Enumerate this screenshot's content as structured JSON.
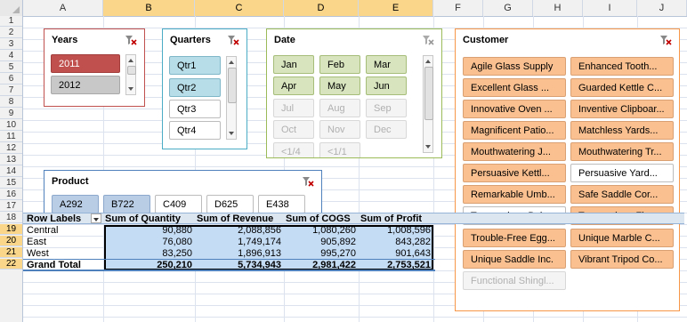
{
  "columns": [
    "A",
    "B",
    "C",
    "D",
    "E",
    "F",
    "G",
    "H",
    "I",
    "J"
  ],
  "rows": [
    "1",
    "2",
    "3",
    "4",
    "5",
    "6",
    "7",
    "8",
    "9",
    "10",
    "11",
    "12",
    "13",
    "14",
    "15",
    "16",
    "17",
    "18",
    "19",
    "20",
    "21",
    "22"
  ],
  "colors": {
    "years_selected": "#c0504d",
    "quarters_selected": "#b7dde8",
    "date_selected": "#d7e4bd",
    "customer_selected": "#fac090",
    "product_selected": "#b9cde5",
    "pivot_selection": "#c5dcf5"
  },
  "slicers": {
    "years": {
      "title": "Years",
      "items": [
        "2011",
        "2012"
      ]
    },
    "quarters": {
      "title": "Quarters",
      "items": [
        "Qtr1",
        "Qtr2",
        "Qtr3",
        "Qtr4"
      ]
    },
    "date": {
      "title": "Date",
      "items": [
        "Jan",
        "Feb",
        "Mar",
        "Apr",
        "May",
        "Jun",
        "Jul",
        "Aug",
        "Sep",
        "Oct",
        "Nov",
        "Dec",
        "<1/4",
        "<1/1"
      ]
    },
    "product": {
      "title": "Product",
      "items": [
        "A292",
        "B722",
        "C409",
        "D625",
        "E438"
      ]
    },
    "customer": {
      "title": "Customer",
      "items": [
        "Agile Glass Supply",
        "Enhanced Tooth...",
        "Excellent Glass ...",
        "Guarded Kettle C...",
        "Innovative Oven ...",
        "Inventive Clipboar...",
        "Magnificent Patio...",
        "Matchless Yards...",
        "Mouthwatering J...",
        "Mouthwatering Tr...",
        "Persuasive Kettl...",
        "Persuasive Yard...",
        "Remarkable Umb...",
        "Safe Saddle Cor...",
        "Tremendous Bob...",
        "Tremendous Flag...",
        "Trouble-Free Egg...",
        "Unique Marble C...",
        "Unique Saddle Inc.",
        "Vibrant Tripod Co...",
        "Functional Shingl..."
      ]
    }
  },
  "pivot": {
    "headers": [
      "Row Labels",
      "Sum of Quantity",
      "Sum of Revenue",
      "Sum of COGS",
      "Sum of Profit"
    ],
    "rows": [
      [
        "Central",
        "90,880",
        "2,088,856",
        "1,080,260",
        "1,008,596"
      ],
      [
        "East",
        "76,080",
        "1,749,174",
        "905,892",
        "843,282"
      ],
      [
        "West",
        "83,250",
        "1,896,913",
        "995,270",
        "901,643"
      ],
      [
        "Grand Total",
        "250,210",
        "5,734,943",
        "2,981,422",
        "2,753,521"
      ]
    ]
  }
}
